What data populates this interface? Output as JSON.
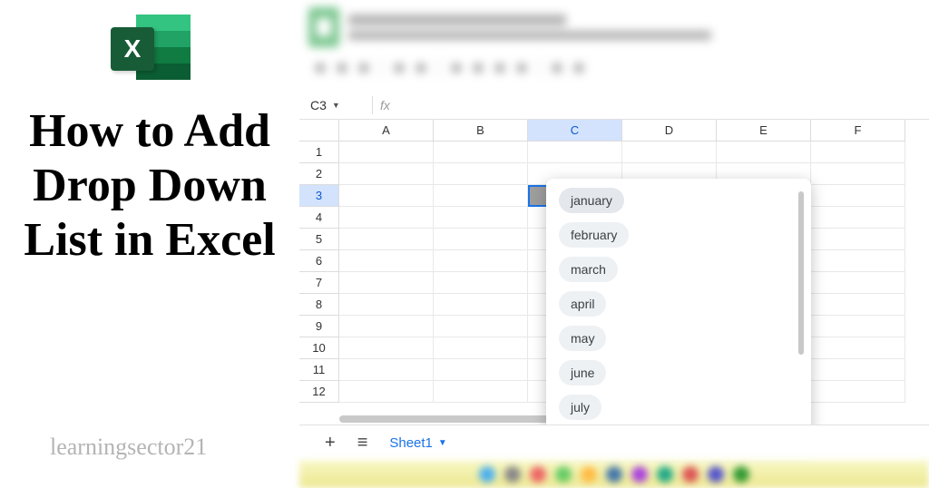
{
  "left": {
    "logo_letter": "X",
    "title": "How to Add Drop Down List in Excel",
    "watermark": "learningsector21"
  },
  "namebox": {
    "cell_ref": "C3",
    "fx_label": "fx"
  },
  "columns": [
    "A",
    "B",
    "C",
    "D",
    "E",
    "F"
  ],
  "active_column": "C",
  "rows": [
    1,
    2,
    3,
    4,
    5,
    6,
    7,
    8,
    9,
    10,
    11,
    12
  ],
  "active_row": 3,
  "dropdown": {
    "items": [
      "january",
      "february",
      "march",
      "april",
      "may",
      "june",
      "july"
    ]
  },
  "sheet_tabs": {
    "plus": "+",
    "menu": "≡",
    "active": "Sheet1"
  }
}
